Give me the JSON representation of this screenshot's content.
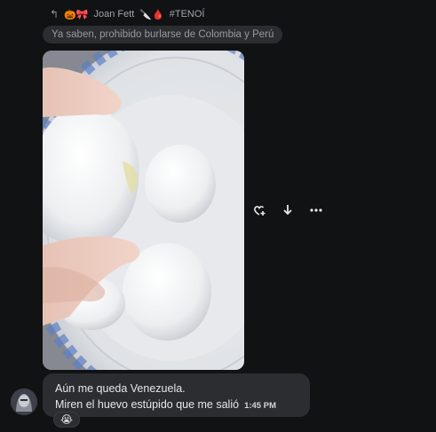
{
  "reply": {
    "author": "Joan Fett",
    "tag": "#TENOÍ",
    "quoted_text": "Ya saben, prohibido burlarse de Colombia y Perú",
    "emoji_prefix": "🎃🎀",
    "emoji_suffix": "🔪🩸"
  },
  "message": {
    "line1": "Aún me queda Venezuela.",
    "line2": "Miren el huevo estúpido que me salió",
    "time": "1:45 PM"
  },
  "reaction": {
    "emoji": "😭"
  },
  "actions": {
    "icons": [
      "add-reaction-icon",
      "download-icon",
      "more-options-icon"
    ]
  }
}
